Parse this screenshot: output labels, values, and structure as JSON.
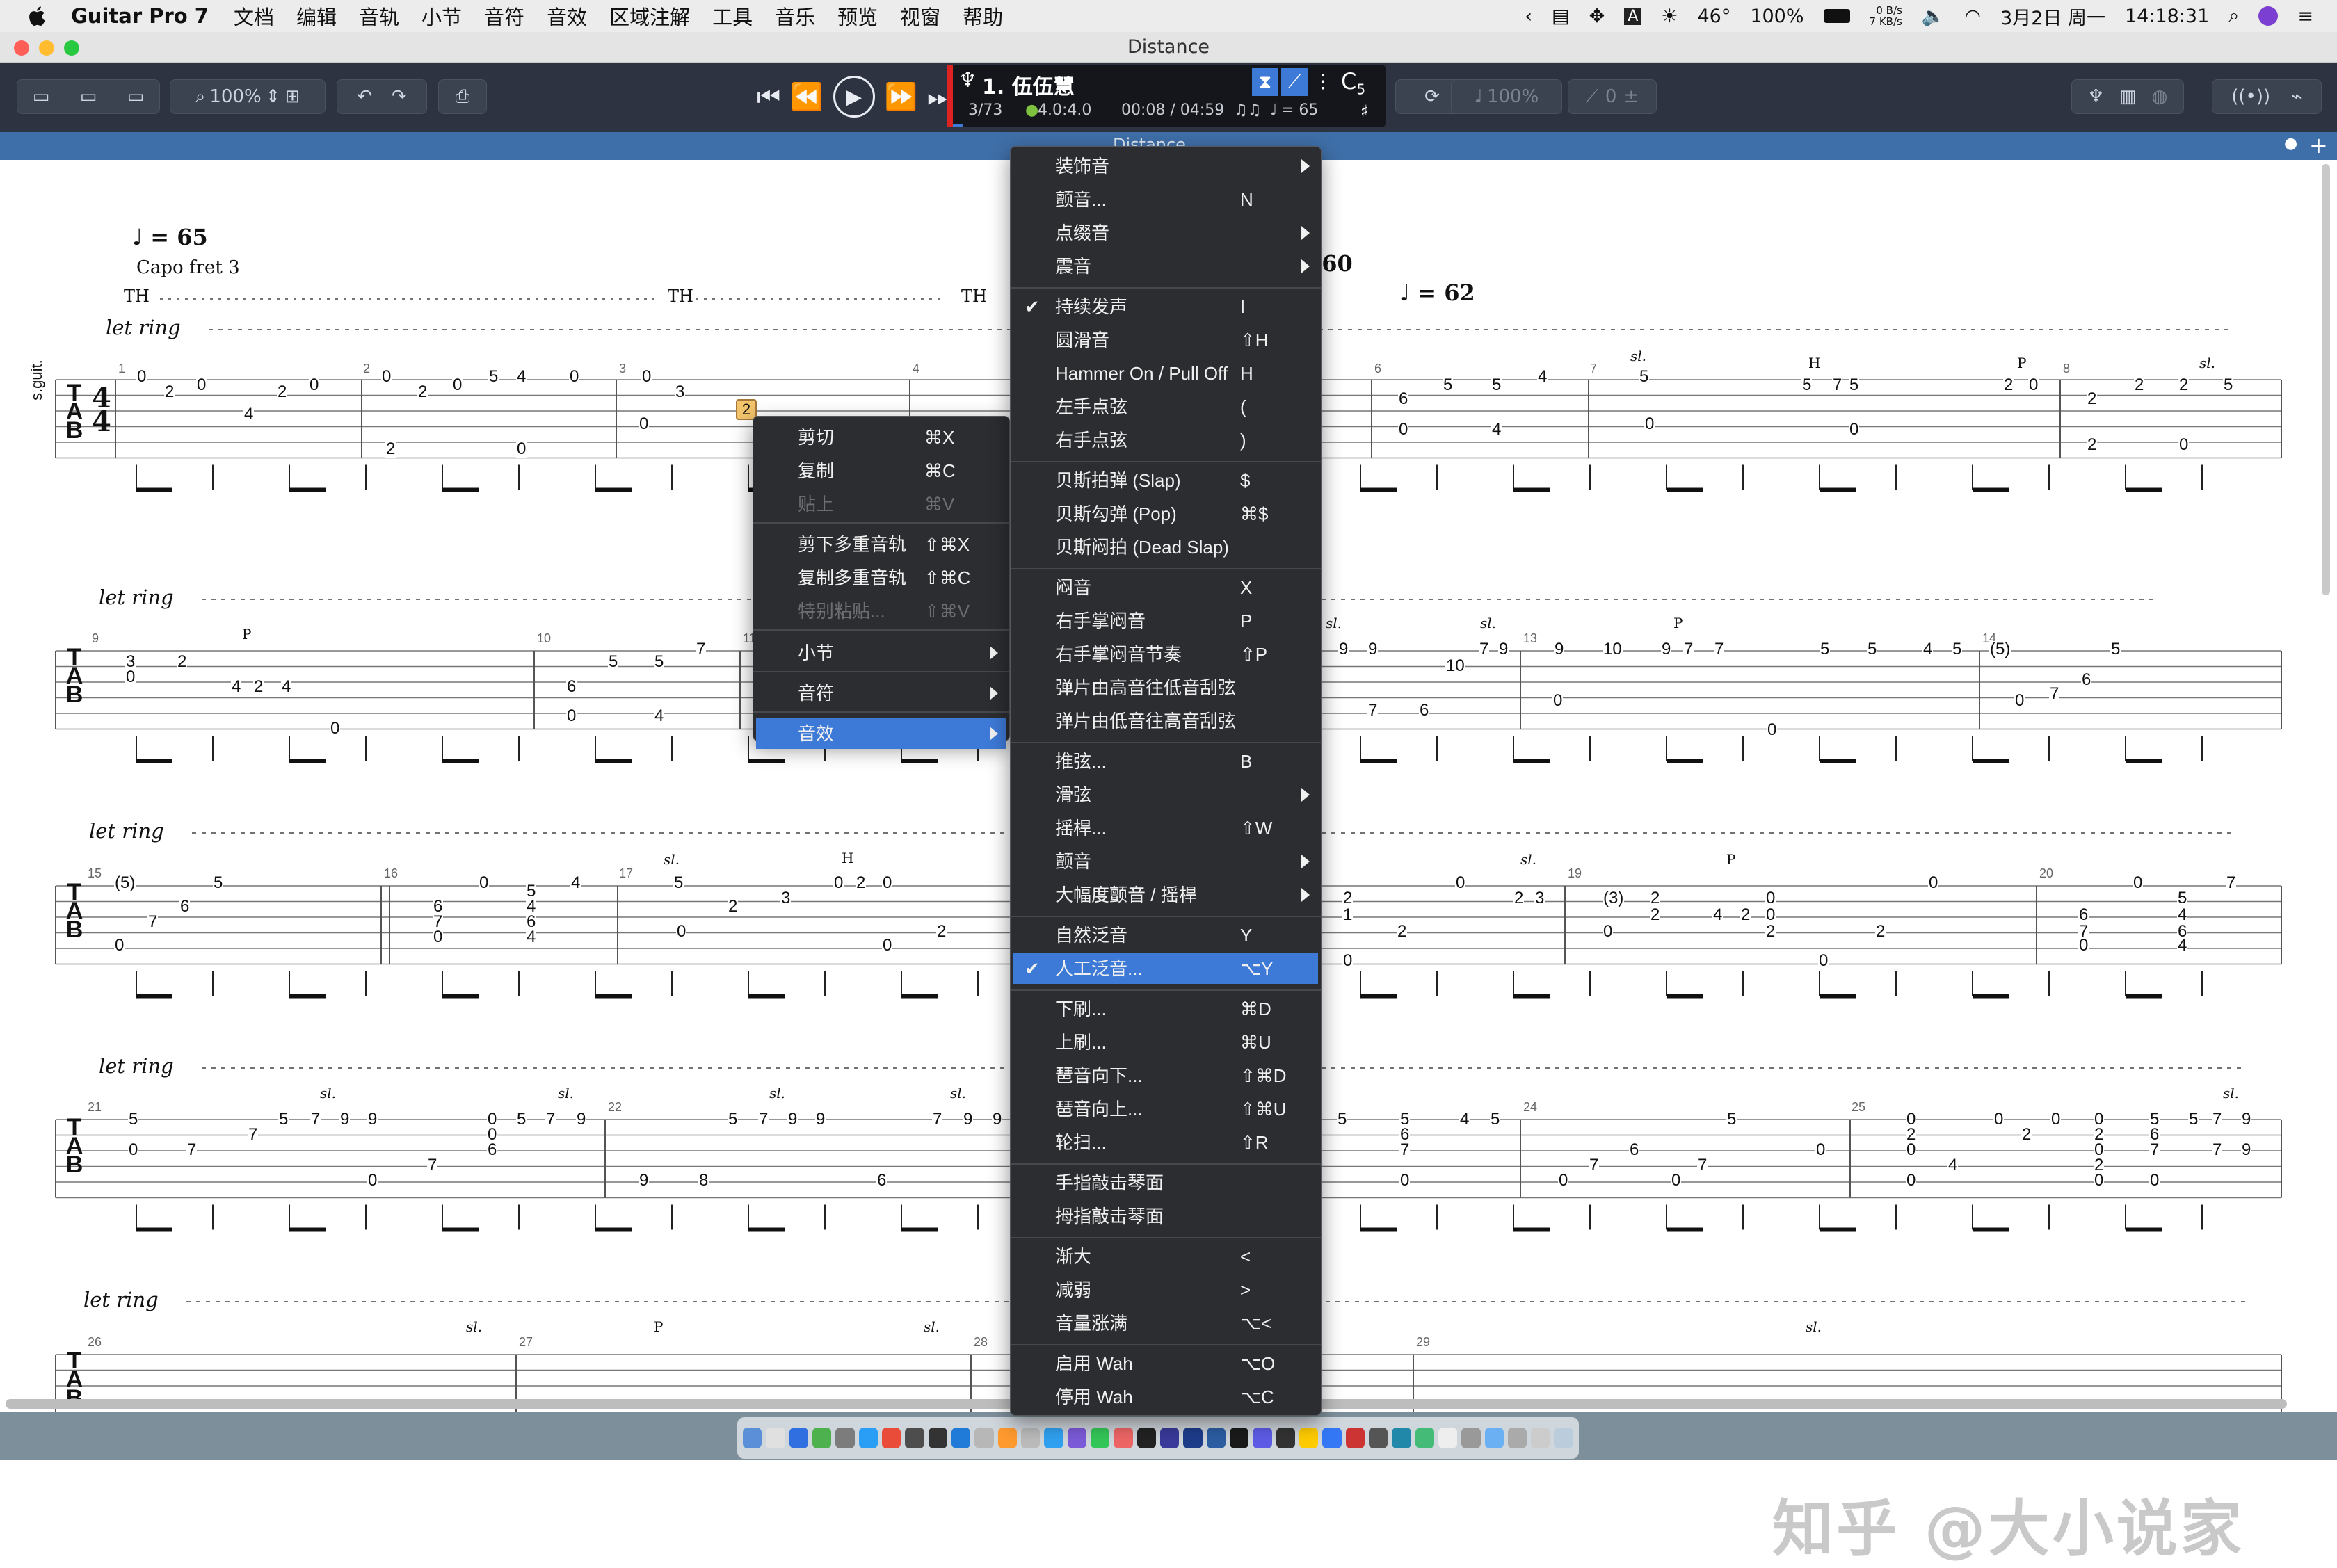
{
  "menubar": {
    "app_name": "Guitar Pro 7",
    "items": [
      "文档",
      "编辑",
      "音轨",
      "小节",
      "音符",
      "音效",
      "区域注解",
      "工具",
      "音乐",
      "预览",
      "视窗",
      "帮助"
    ],
    "temperature": "46°",
    "battery": "100%",
    "net_up": "0 B/s",
    "net_down": "7 KB/s",
    "date": "3月2日 周一",
    "time": "14:18:31"
  },
  "window": {
    "title": "Distance",
    "tab_title": "Distance"
  },
  "toolbar": {
    "zoom": "100%",
    "lcd": {
      "track": "1. 伍伍慧",
      "bar_pos": "3/73",
      "time_sig": "4.0:4.0",
      "time": "00:08 / 04:59",
      "tempo": "= 65",
      "key": "C",
      "key_num": "5"
    },
    "speed": "100%",
    "counter": "0"
  },
  "score": {
    "tempo_marks": [
      "= 65",
      "= 60",
      "= 62"
    ],
    "capo": "Capo fret 3",
    "th_label": "TH",
    "let_ring": "let ring",
    "track_label": "s.guit.",
    "tab_letters": [
      "T",
      "A",
      "B"
    ],
    "bar_numbers": [
      "1",
      "2",
      "3",
      "4",
      "6",
      "7",
      "8",
      "9",
      "10",
      "11",
      "13",
      "14",
      "15",
      "16",
      "17",
      "19",
      "20",
      "21",
      "22",
      "24",
      "25",
      "26",
      "27",
      "28",
      "29"
    ],
    "annotations": {
      "slide": "sl.",
      "hammer": "H",
      "pull": "P",
      "selected_beat": "2"
    }
  },
  "context_menu": {
    "items": [
      {
        "label": "剪切",
        "shortcut": "⌘X",
        "disabled": false
      },
      {
        "label": "复制",
        "shortcut": "⌘C",
        "disabled": false
      },
      {
        "label": "贴上",
        "shortcut": "⌘V",
        "disabled": true
      },
      {
        "label": "剪下多重音轨",
        "shortcut": "⇧⌘X",
        "disabled": false
      },
      {
        "label": "复制多重音轨",
        "shortcut": "⇧⌘C",
        "disabled": false
      },
      {
        "label": "特别粘贴...",
        "shortcut": "⇧⌘V",
        "disabled": true
      },
      {
        "label": "小节",
        "submenu": true
      },
      {
        "label": "音符",
        "submenu": true
      },
      {
        "label": "音效",
        "submenu": true,
        "highlighted": true
      }
    ]
  },
  "effects_menu": {
    "items": [
      {
        "label": "装饰音",
        "submenu": true
      },
      {
        "label": "颤音...",
        "shortcut": "N"
      },
      {
        "label": "点缀音",
        "submenu": true
      },
      {
        "label": "震音",
        "submenu": true
      },
      {
        "label": "持续发声",
        "shortcut": "I",
        "checked": true
      },
      {
        "label": "圆滑音",
        "shortcut": "⇧H"
      },
      {
        "label": "Hammer On / Pull Off",
        "shortcut": "H"
      },
      {
        "label": "左手点弦",
        "shortcut": "("
      },
      {
        "label": "右手点弦",
        "shortcut": ")"
      },
      {
        "label": "贝斯拍弹 (Slap)",
        "shortcut": "$"
      },
      {
        "label": "贝斯勾弹 (Pop)",
        "shortcut": "⌘$"
      },
      {
        "label": "贝斯闷拍 (Dead Slap)",
        "shortcut": ""
      },
      {
        "label": "闷音",
        "shortcut": "X"
      },
      {
        "label": "右手掌闷音",
        "shortcut": "P"
      },
      {
        "label": "右手掌闷音节奏",
        "shortcut": "⇧P"
      },
      {
        "label": "弹片由高音往低音刮弦",
        "shortcut": ""
      },
      {
        "label": "弹片由低音往高音刮弦",
        "shortcut": ""
      },
      {
        "label": "推弦...",
        "shortcut": "B"
      },
      {
        "label": "滑弦",
        "submenu": true
      },
      {
        "label": "摇桿...",
        "shortcut": "⇧W"
      },
      {
        "label": "颤音",
        "submenu": true
      },
      {
        "label": "大幅度颤音 / 摇桿",
        "submenu": true
      },
      {
        "label": "自然泛音",
        "shortcut": "Y"
      },
      {
        "label": "人工泛音...",
        "shortcut": "⌥Y",
        "checked": true,
        "highlighted": true
      },
      {
        "label": "下刷...",
        "shortcut": "⌘D"
      },
      {
        "label": "上刷...",
        "shortcut": "⌘U"
      },
      {
        "label": "琶音向下...",
        "shortcut": "⇧⌘D"
      },
      {
        "label": "琶音向上...",
        "shortcut": "⇧⌘U"
      },
      {
        "label": "轮扫...",
        "shortcut": "⇧R"
      },
      {
        "label": "手指敲击琴面",
        "shortcut": ""
      },
      {
        "label": "拇指敲击琴面",
        "shortcut": ""
      },
      {
        "label": "渐大",
        "shortcut": "<"
      },
      {
        "label": "减弱",
        "shortcut": ">"
      },
      {
        "label": "音量涨满",
        "shortcut": "⌥<"
      },
      {
        "label": "启用 Wah",
        "shortcut": "⌥O"
      },
      {
        "label": "停用 Wah",
        "shortcut": "⌥C"
      }
    ]
  },
  "watermark": "知乎 @大小说家",
  "colors": {
    "toolbar": "#2d3340",
    "menu_bg": "#2b2d31",
    "highlight": "#3d79d6",
    "tab_bar": "#3f6fa8"
  }
}
